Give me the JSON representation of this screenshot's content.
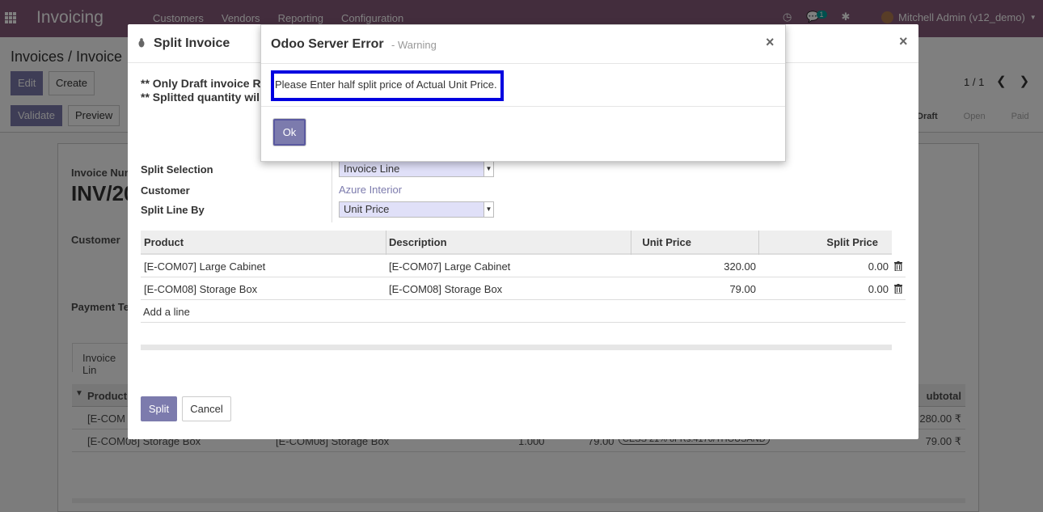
{
  "topbar": {
    "app_name": "Invoicing",
    "menu": [
      "Customers",
      "Vendors",
      "Reporting",
      "Configuration"
    ],
    "chat_badge": "1",
    "user": "Mitchell Admin (v12_demo)"
  },
  "control_panel": {
    "breadcrumb": "Invoices / Invoice",
    "edit_label": "Edit",
    "create_label": "Create",
    "validate_label": "Validate",
    "preview_label": "Preview",
    "pager": "1 / 1",
    "status": [
      "Draft",
      "Open",
      "Paid"
    ]
  },
  "background_sheet": {
    "invoice_number_label": "Invoice Num",
    "invoice_number": "INV/20",
    "customer_label": "Customer",
    "payment_terms_label": "Payment Te",
    "tab_label": "Invoice Lin",
    "col_product": "Product",
    "col_subtotal": "ubtotal",
    "rows": [
      {
        "product": "[E-COM",
        "subtotal": "280.00 ₹"
      },
      {
        "product": "[E-COM08] Storage Box",
        "description": "[E-COM08] Storage Box",
        "qty": "1.000",
        "price": "79.00",
        "tax": "CESS 21% or Rs.4170/THOUSAND",
        "subtotal": "79.00 ₹"
      }
    ]
  },
  "split_modal": {
    "title": "Split Invoice",
    "note_1": "** Only Draft invoice R",
    "note_2": "** Splitted quantity wil",
    "split_selection_label": "Split Selection",
    "split_selection_value": "Invoice Line",
    "customer_label": "Customer",
    "customer_value": "Azure Interior",
    "split_line_by_label": "Split Line By",
    "split_line_by_value": "Unit Price",
    "columns": {
      "product": "Product",
      "description": "Description",
      "unit_price": "Unit Price",
      "split_price": "Split Price"
    },
    "lines": [
      {
        "product": "[E-COM07] Large Cabinet",
        "description": "[E-COM07] Large Cabinet",
        "unit_price": "320.00",
        "split_price": "0.00"
      },
      {
        "product": "[E-COM08] Storage Box",
        "description": "[E-COM08] Storage Box",
        "unit_price": "79.00",
        "split_price": "0.00"
      }
    ],
    "add_line": "Add a line",
    "split_button": "Split",
    "cancel_button": "Cancel"
  },
  "error_modal": {
    "title": "Odoo Server Error",
    "subtitle": "- Warning",
    "message": "Please Enter half split price of Actual Unit Price.",
    "ok_button": "Ok"
  }
}
